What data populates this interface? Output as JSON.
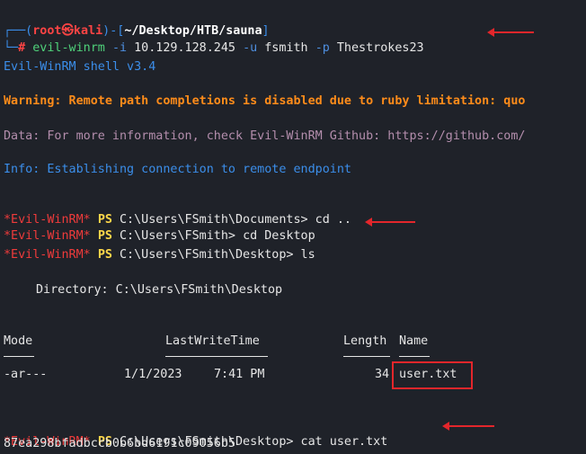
{
  "prompt_header": {
    "corner_top": "┌──(",
    "user": "root",
    "at_symbol": "㉿",
    "host": "kali",
    "bracket_mid": ")-[",
    "path": "~/Desktop/HTB/sauna",
    "bracket_end": "]",
    "corner_bottom": "└─",
    "hash": "#",
    "command_name": "evil-winrm",
    "flag_i": "-i",
    "ip": "10.129.128.245",
    "flag_u": "-u",
    "user_arg": "fsmith",
    "flag_p": "-p",
    "password": "Thestrokes23"
  },
  "output": {
    "shell_version": "Evil-WinRM shell v3.4",
    "warning": "Warning: Remote path completions is disabled due to ruby limitation: quo",
    "data_line": "Data: For more information, check Evil-WinRM Github: https://github.com/",
    "info_line": "Info: Establishing connection to remote endpoint"
  },
  "evil_prompt": {
    "label": "*Evil-WinRM*",
    "ps": "PS"
  },
  "commands": [
    {
      "path": "C:\\Users\\FSmith\\Documents>",
      "cmd": "cd .."
    },
    {
      "path": "C:\\Users\\FSmith>",
      "cmd": "cd Desktop"
    },
    {
      "path": "C:\\Users\\FSmith\\Desktop>",
      "cmd": "ls"
    },
    {
      "path": "C:\\Users\\FSmith\\Desktop>",
      "cmd": "cat user.txt"
    }
  ],
  "directory_listing": {
    "header": "Directory: C:\\Users\\FSmith\\Desktop",
    "columns": {
      "mode": "Mode",
      "last_write_time": "LastWriteTime",
      "length": "Length",
      "name": "Name"
    },
    "underline_mode": "----",
    "underline_lwt": "-------------",
    "underline_length": "------",
    "underline_name": "----",
    "row": {
      "mode": "-ar---",
      "date": "1/1/2023",
      "time": "7:41 PM",
      "length": "34",
      "name": "user.txt"
    }
  },
  "flag_output": "87ea298bfadbccb0b6bd6191c09056b5",
  "colors": {
    "background": "#1f2229",
    "annotation_red": "#e3262b",
    "prompt_blue": "#3b8eea",
    "warning_orange": "#ff8c1a",
    "data_purple": "#b48ead",
    "evil_red": "#ef3b3b",
    "ps_yellow": "#ffd84a"
  }
}
